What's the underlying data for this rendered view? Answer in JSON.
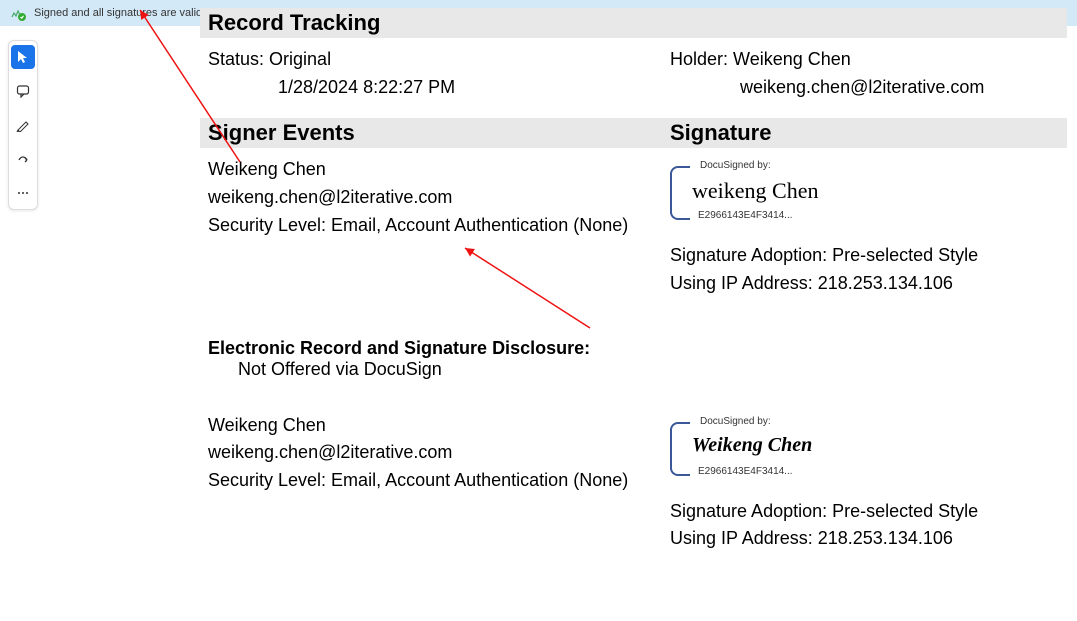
{
  "banner": {
    "message": "Signed and all signatures are valid."
  },
  "record_tracking": {
    "header": "Record Tracking",
    "status_label": "Status:",
    "status_value": "Original",
    "timestamp": "1/28/2024 8:22:27 PM",
    "holder_label": "Holder:",
    "holder_name": "Weikeng Chen",
    "holder_email": "weikeng.chen@l2iterative.com"
  },
  "signer_events": {
    "header": "Signer Events",
    "signature_header": "Signature",
    "signers": [
      {
        "name": "Weikeng Chen",
        "email": "weikeng.chen@l2iterative.com",
        "security": "Security Level: Email, Account Authentication (None)",
        "docusigned_by": "DocuSigned by:",
        "script_name": "weikeng Chen",
        "sig_id": "E2966143E4F3414...",
        "adoption": "Signature Adoption: Pre-selected Style",
        "ip": "Using IP Address: 218.253.134.106"
      },
      {
        "name": "Weikeng Chen",
        "email": "weikeng.chen@l2iterative.com",
        "security": "Security Level: Email, Account Authentication (None)",
        "docusigned_by": "DocuSigned by:",
        "script_name": "Weikeng Chen",
        "sig_id": "E2966143E4F3414...",
        "adoption": "Signature Adoption: Pre-selected Style",
        "ip": "Using IP Address: 218.253.134.106"
      }
    ]
  },
  "disclosure": {
    "title": "Electronic Record and Signature Disclosure:",
    "subtitle": "Not Offered via DocuSign"
  }
}
